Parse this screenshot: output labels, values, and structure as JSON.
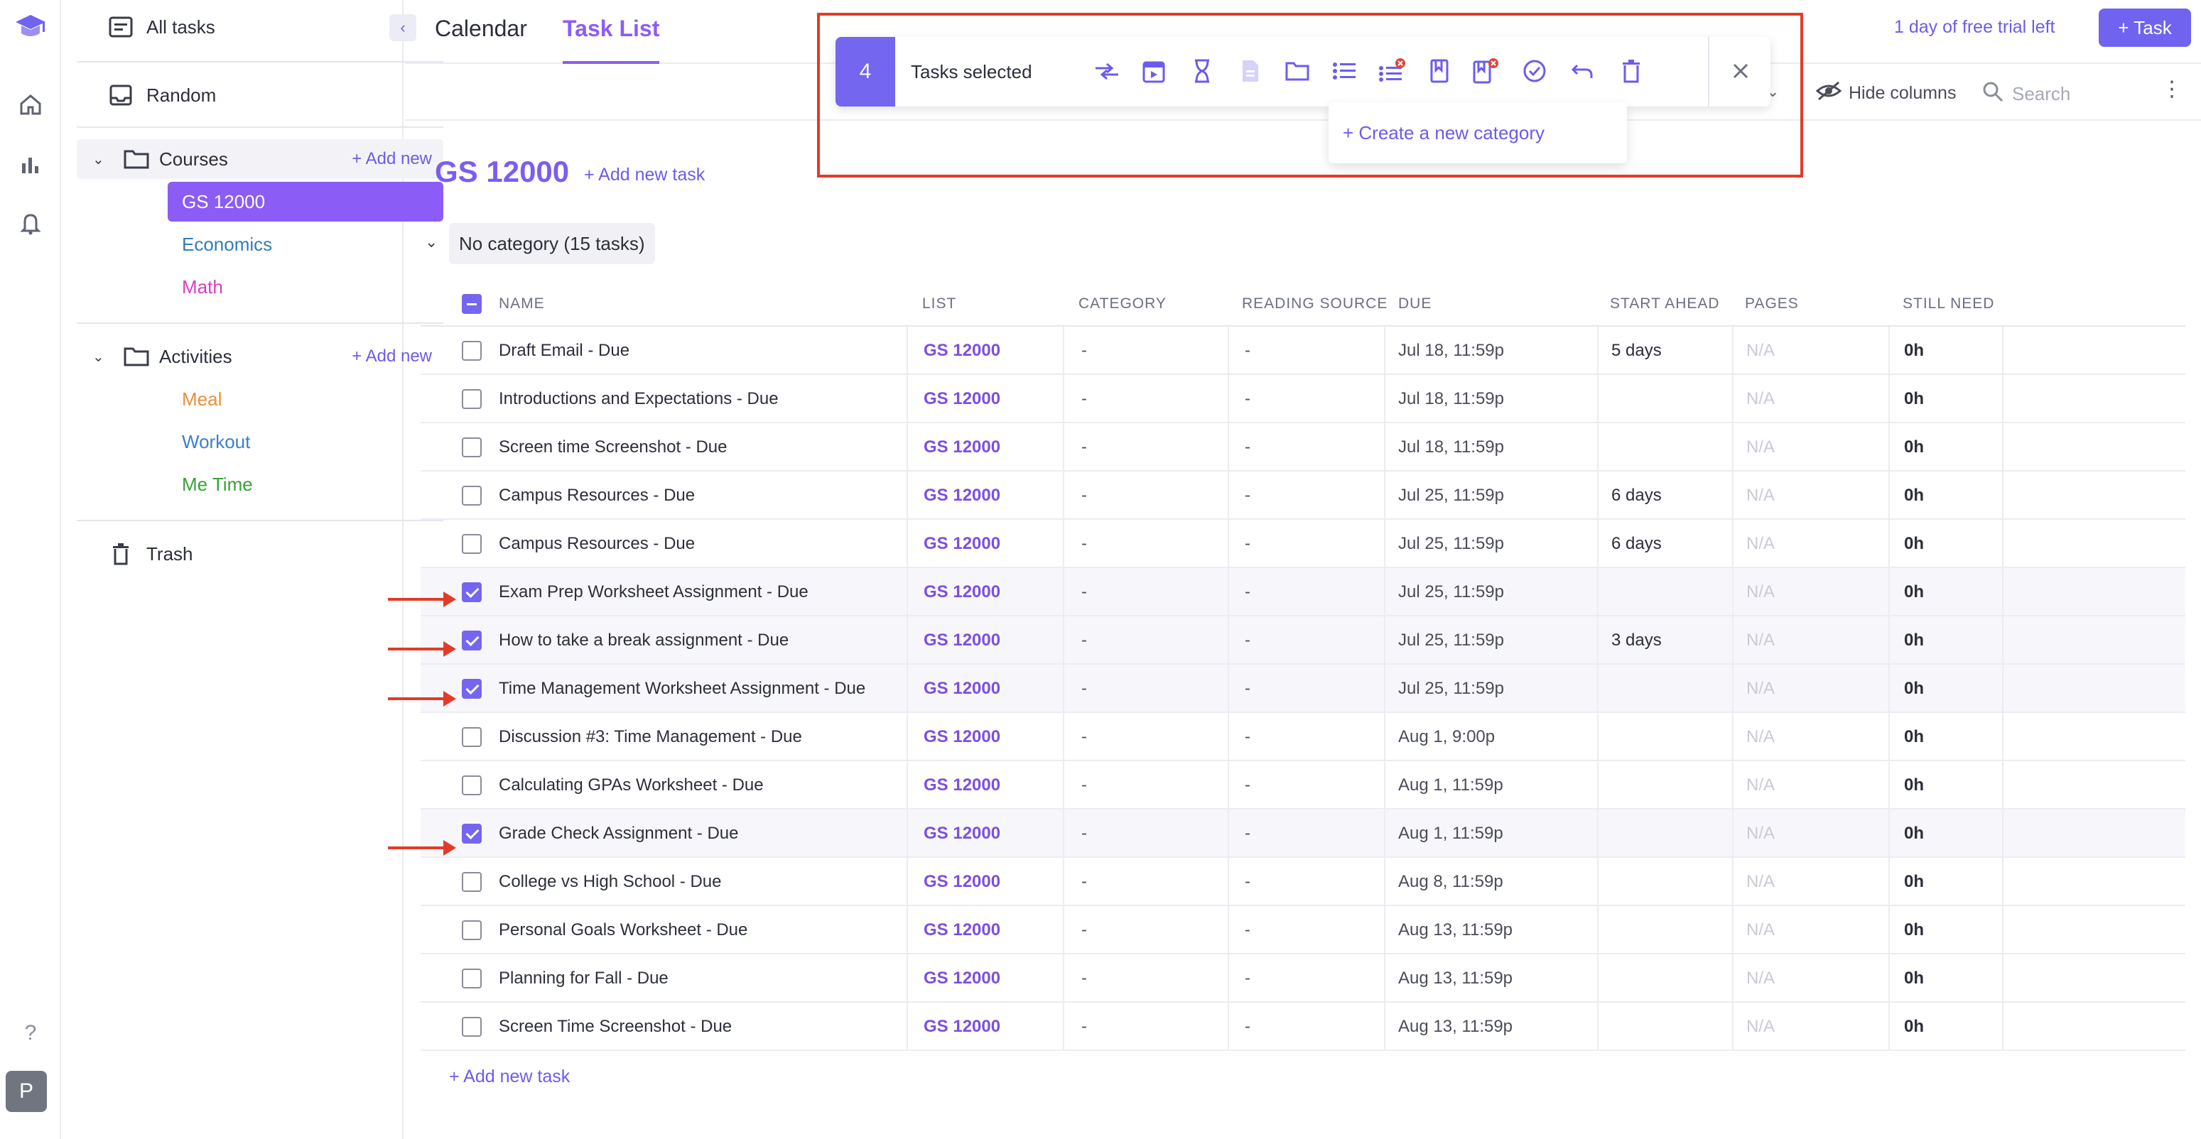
{
  "sidebar": {
    "all_tasks": "All tasks",
    "random": "Random",
    "courses": {
      "label": "Courses",
      "add": "+ Add new",
      "items": [
        {
          "label": "GS 12000",
          "color": "#ffffff",
          "active": true
        },
        {
          "label": "Economics",
          "color": "#2f7fb8"
        },
        {
          "label": "Math",
          "color": "#d63fc4"
        }
      ]
    },
    "activities": {
      "label": "Activities",
      "add": "+ Add new",
      "items": [
        {
          "label": "Meal",
          "color": "#e8903a"
        },
        {
          "label": "Workout",
          "color": "#3a7fcf"
        },
        {
          "label": "Me Time",
          "color": "#3aa03a"
        }
      ]
    },
    "trash": "Trash",
    "help": "?",
    "avatar": "P"
  },
  "header": {
    "tab_calendar": "Calendar",
    "tab_task_list": "Task List",
    "trial": "1 day of free trial left",
    "add_task": "+ Task"
  },
  "toolbar": {
    "hide_columns": "Hide columns",
    "search_placeholder": "Search"
  },
  "selection": {
    "count": "4",
    "label": "Tasks selected",
    "create_category": "+ Create a new category"
  },
  "course": {
    "title": "GS 12000",
    "add_task": "+ Add new task",
    "category": "No category (15 tasks)"
  },
  "columns": [
    "NAME",
    "LIST",
    "CATEGORY",
    "READING SOURCE",
    "DUE",
    "START AHEAD",
    "PAGES",
    "STILL NEED"
  ],
  "rows": [
    {
      "name": "Draft Email - Due",
      "list": "GS 12000",
      "category": "-",
      "reading_source": "-",
      "due": "Jul 18, 11:59p",
      "start_ahead": "5 days",
      "pages": "N/A",
      "still_need": "0h",
      "checked": false
    },
    {
      "name": "Introductions and Expectations - Due",
      "list": "GS 12000",
      "category": "-",
      "reading_source": "-",
      "due": "Jul 18, 11:59p",
      "start_ahead": "",
      "pages": "N/A",
      "still_need": "0h",
      "checked": false
    },
    {
      "name": "Screen time Screenshot - Due",
      "list": "GS 12000",
      "category": "-",
      "reading_source": "-",
      "due": "Jul 18, 11:59p",
      "start_ahead": "",
      "pages": "N/A",
      "still_need": "0h",
      "checked": false
    },
    {
      "name": "Campus Resources - Due",
      "list": "GS 12000",
      "category": "-",
      "reading_source": "-",
      "due": "Jul 25, 11:59p",
      "start_ahead": "6 days",
      "pages": "N/A",
      "still_need": "0h",
      "checked": false
    },
    {
      "name": "Campus Resources - Due",
      "list": "GS 12000",
      "category": "-",
      "reading_source": "-",
      "due": "Jul 25, 11:59p",
      "start_ahead": "6 days",
      "pages": "N/A",
      "still_need": "0h",
      "checked": false
    },
    {
      "name": "Exam Prep Worksheet Assignment - Due",
      "list": "GS 12000",
      "category": "-",
      "reading_source": "-",
      "due": "Jul 25, 11:59p",
      "start_ahead": "",
      "pages": "N/A",
      "still_need": "0h",
      "checked": true
    },
    {
      "name": "How to take a break assignment - Due",
      "list": "GS 12000",
      "category": "-",
      "reading_source": "-",
      "due": "Jul 25, 11:59p",
      "start_ahead": "3 days",
      "pages": "N/A",
      "still_need": "0h",
      "checked": true
    },
    {
      "name": "Time Management Worksheet Assignment - Due",
      "list": "GS 12000",
      "category": "-",
      "reading_source": "-",
      "due": "Jul 25, 11:59p",
      "start_ahead": "",
      "pages": "N/A",
      "still_need": "0h",
      "checked": true
    },
    {
      "name": "Discussion #3: Time Management - Due",
      "list": "GS 12000",
      "category": "-",
      "reading_source": "-",
      "due": "Aug 1, 9:00p",
      "start_ahead": "",
      "pages": "N/A",
      "still_need": "0h",
      "checked": false
    },
    {
      "name": "Calculating GPAs Worksheet - Due",
      "list": "GS 12000",
      "category": "-",
      "reading_source": "-",
      "due": "Aug 1, 11:59p",
      "start_ahead": "",
      "pages": "N/A",
      "still_need": "0h",
      "checked": false
    },
    {
      "name": "Grade Check Assignment - Due",
      "list": "GS 12000",
      "category": "-",
      "reading_source": "-",
      "due": "Aug 1, 11:59p",
      "start_ahead": "",
      "pages": "N/A",
      "still_need": "0h",
      "checked": true
    },
    {
      "name": "College vs High School - Due",
      "list": "GS 12000",
      "category": "-",
      "reading_source": "-",
      "due": "Aug 8, 11:59p",
      "start_ahead": "",
      "pages": "N/A",
      "still_need": "0h",
      "checked": false
    },
    {
      "name": "Personal Goals Worksheet - Due",
      "list": "GS 12000",
      "category": "-",
      "reading_source": "-",
      "due": "Aug 13, 11:59p",
      "start_ahead": "",
      "pages": "N/A",
      "still_need": "0h",
      "checked": false
    },
    {
      "name": "Planning for Fall - Due",
      "list": "GS 12000",
      "category": "-",
      "reading_source": "-",
      "due": "Aug 13, 11:59p",
      "start_ahead": "",
      "pages": "N/A",
      "still_need": "0h",
      "checked": false
    },
    {
      "name": "Screen Time Screenshot - Due",
      "list": "GS 12000",
      "category": "-",
      "reading_source": "-",
      "due": "Aug 13, 11:59p",
      "start_ahead": "",
      "pages": "N/A",
      "still_need": "0h",
      "checked": false
    }
  ],
  "add_bottom": "+ Add new task",
  "colors": {
    "accent": "#7466ee",
    "annotation": "#e23b27"
  }
}
